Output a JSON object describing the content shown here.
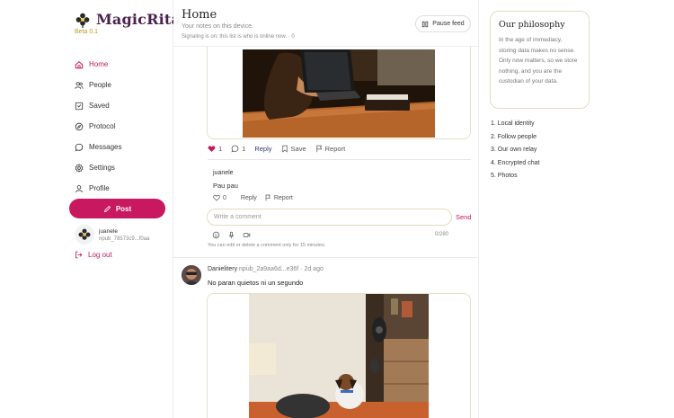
{
  "app": {
    "name": "MagicRita",
    "version": "Beta 0.1"
  },
  "nav": [
    {
      "label": "Home",
      "icon": "home-icon",
      "active": true
    },
    {
      "label": "People",
      "icon": "people-icon"
    },
    {
      "label": "Saved",
      "icon": "bookmark-icon"
    },
    {
      "label": "Protocol",
      "icon": "compass-icon"
    },
    {
      "label": "Messages",
      "icon": "chat-icon"
    },
    {
      "label": "Settings",
      "icon": "gear-icon"
    },
    {
      "label": "Profile",
      "icon": "user-icon"
    }
  ],
  "post_button": "Post",
  "account": {
    "name": "juanele",
    "pubkey": "npub_78573c9...f0aa"
  },
  "logout": "Log out",
  "header": {
    "title": "Home",
    "subtitle": "Your notes on this device.",
    "signaling": "Signaling is on: this list is who is online now. · 0",
    "pause_label": "Pause feed"
  },
  "post1": {
    "likes": "1",
    "comments": "1",
    "reply": "Reply",
    "save": "Save",
    "report": "Report",
    "comment": {
      "author": "juanele",
      "text": "Pau pau",
      "likes": "0",
      "reply": "Reply",
      "report": "Report"
    },
    "comment_placeholder": "Write a comment",
    "send": "Send",
    "char_count": "0/280",
    "hint": "You can edit or delete a comment only for 15 minutes."
  },
  "post2": {
    "author": "Danielitery",
    "pubkey": "npub_2a9aa6d...e36f",
    "time": "· 2d ago",
    "text": "No paran quietos ni un segundo"
  },
  "philosophy": {
    "title": "Our philosophy",
    "text": "In the age of immediacy, storing data makes no sense. Only now matters, so we store nothing, and you are the custodian of your data."
  },
  "roadmap": [
    "1. Local identity",
    "2. Follow people",
    "3. Our own relay",
    "4. Encrypted chat",
    "5. Photos"
  ],
  "colors": {
    "accent": "#c8185f",
    "brand": "#4a2050",
    "beta": "#c09a1e",
    "card_border": "#e6e0c8"
  }
}
